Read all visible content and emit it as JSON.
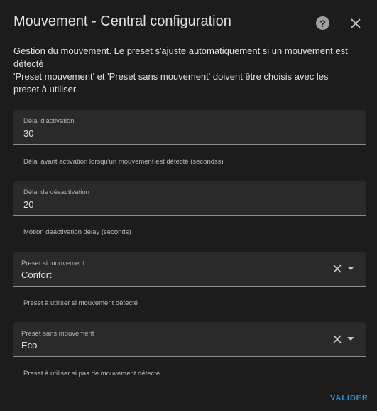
{
  "dialog": {
    "title": "Mouvement - Central configuration",
    "description_line1": "Gestion du mouvement. Le preset s'ajuste automatiquement si un mouvement est",
    "description_line2": "détecté",
    "description_line3": "'Preset mouvement' et 'Preset sans mouvement' doivent être choisis avec les",
    "description_line4": "preset à utiliser.",
    "icons": {
      "help": "help-circle-icon",
      "close": "close-icon"
    }
  },
  "fields": {
    "activation": {
      "label": "Délai d'activation",
      "value": "30",
      "helper": "Délai avant activation lorsqu'un mouvement est détecté (secondss)"
    },
    "deactivation": {
      "label": "Délai de désactivation",
      "value": "20",
      "helper": "Motion deactivation delay (seconds)"
    },
    "preset_motion": {
      "label": "Preset si mouvement",
      "value": "Confort",
      "helper": "Preset à utiliser si mouvement détecté"
    },
    "preset_no_motion": {
      "label": "Preset sans mouvement",
      "value": "Eco",
      "helper": "Preset à utiliser si pas de mouvement détecté"
    }
  },
  "actions": {
    "submit_label": "VALIDER",
    "accent_color": "#2f8fd6"
  }
}
